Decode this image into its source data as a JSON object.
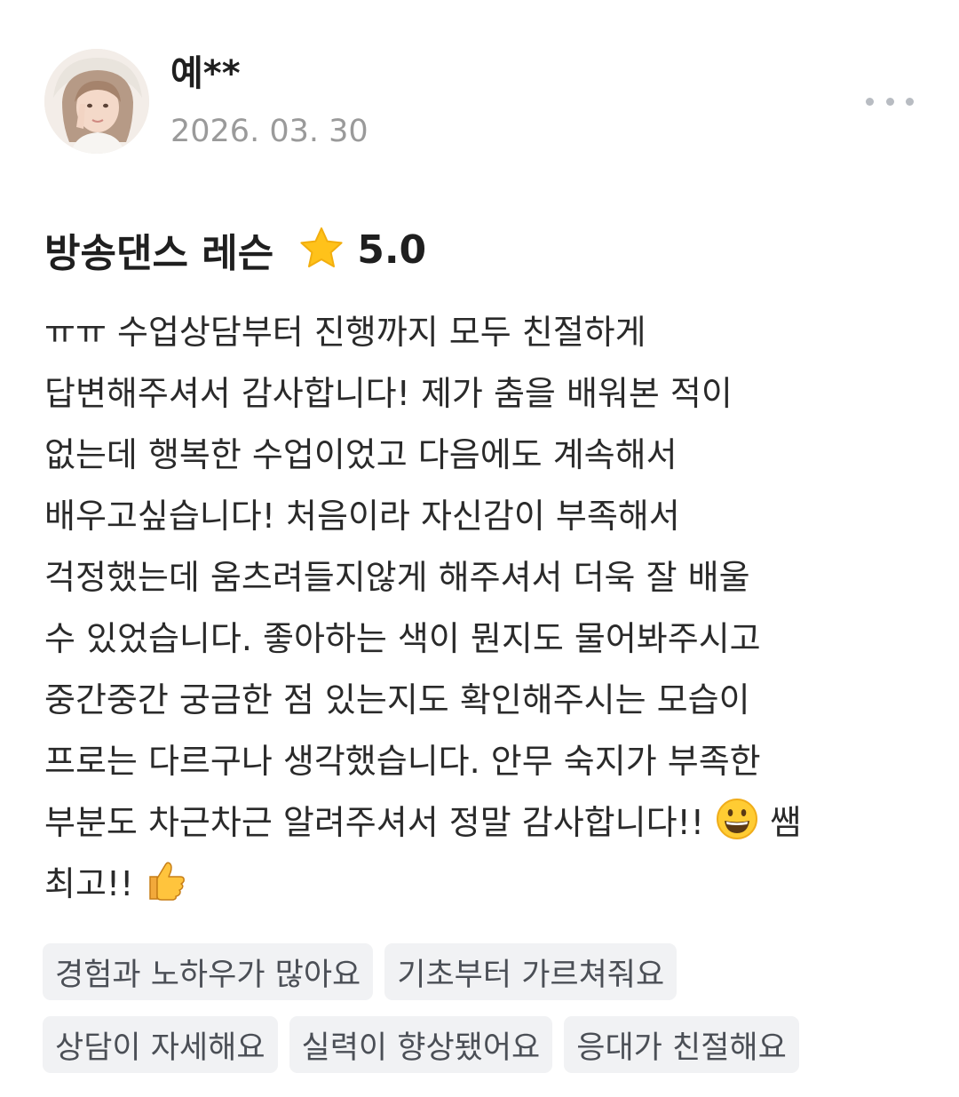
{
  "review": {
    "author": "예**",
    "date": "2026. 03. 30",
    "lesson_title": "방송댄스 레슨",
    "rating": "5.0",
    "body_lines": [
      "ㅠㅠ 수업상담부터 진행까지 모두 친절하게",
      "답변해주셔서 감사합니다! 제가 춤을 배워본 적이",
      "없는데 행복한 수업이었고 다음에도 계속해서",
      "배우고싶습니다! 처음이라 자신감이 부족해서",
      "걱정했는데 움츠려들지않게 해주셔서 더욱 잘 배울",
      "수 있었습니다. 좋아하는 색이 뭔지도 물어봐주시고",
      "중간중간 궁금한 점 있는지도 확인해주시는 모습이",
      "프로는 다르구나 생각했습니다. 안무 숙지가 부족한",
      "부분도 차근차근 알려주셔서 정말 감사합니다!! ",
      " 쌤",
      "최고!! "
    ],
    "tags": [
      "경험과 노하우가 많아요",
      "기초부터 가르쳐줘요",
      "상담이 자세해요",
      "실력이 향상됐어요",
      "응대가 친절해요"
    ]
  },
  "icons": {
    "more": "more-horizontal-icon",
    "star": "star-icon",
    "emoji_1": "grinning-face-emoji",
    "emoji_2": "thumbs-up-emoji"
  },
  "colors": {
    "star": "#FFC21A",
    "date": "#9A9A9A",
    "tag_background": "#F1F2F4",
    "tag_text": "#4B4F56"
  }
}
